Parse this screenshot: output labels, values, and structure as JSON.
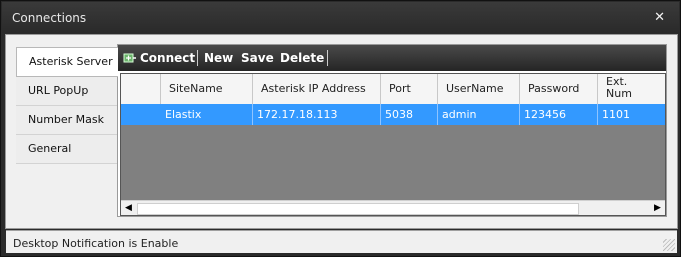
{
  "window": {
    "title": "Connections",
    "close_glyph": "✕"
  },
  "tabs": [
    {
      "label": "Asterisk Server",
      "active": true
    },
    {
      "label": "URL PopUp"
    },
    {
      "label": "Number Mask"
    },
    {
      "label": "General"
    }
  ],
  "toolbar": {
    "connect_label": "Connect",
    "new_label": "New",
    "save_label": "Save",
    "delete_label": "Delete"
  },
  "grid": {
    "columns": [
      "SiteName",
      "Asterisk IP Address",
      "Port",
      "UserName",
      "Password",
      "Ext.\nNum"
    ],
    "rows": [
      [
        "Elastix",
        "172.17.18.113",
        "5038",
        "admin",
        "123456",
        "1101"
      ]
    ]
  },
  "status": {
    "text": "Desktop Notification is Enable"
  }
}
